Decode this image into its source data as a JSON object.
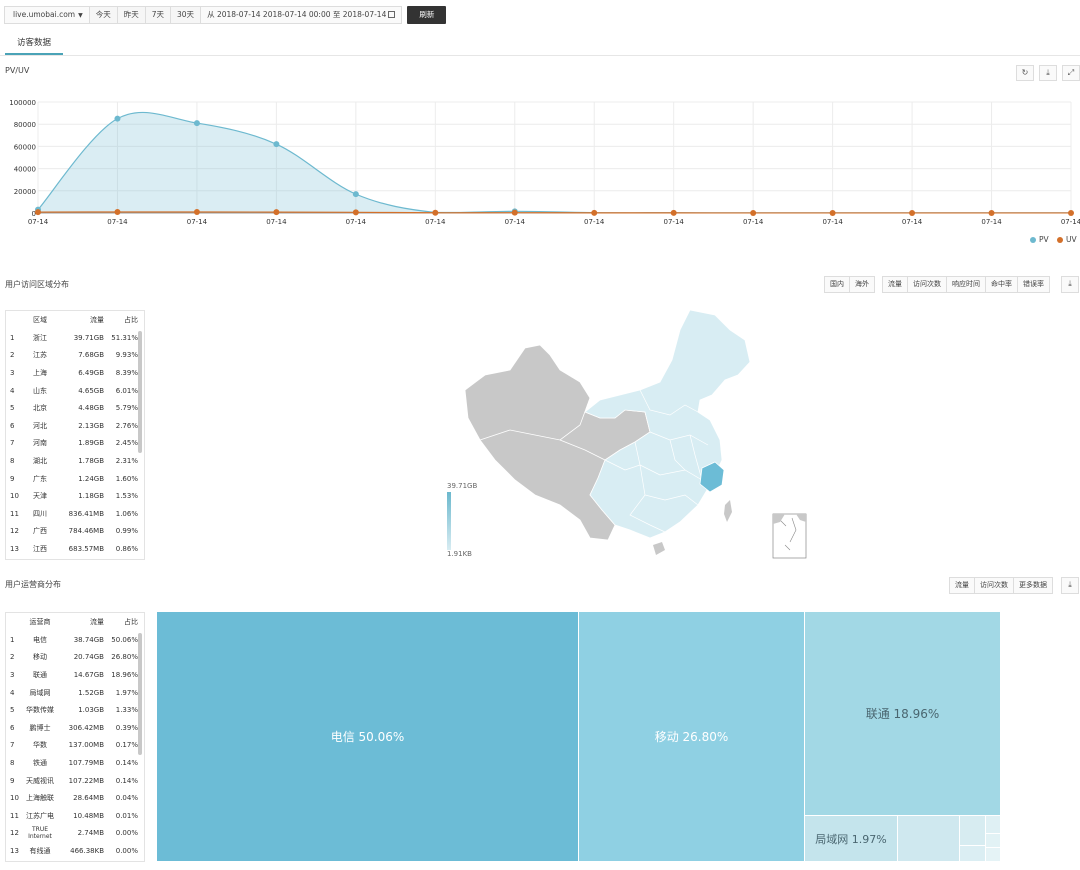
{
  "toolbar": {
    "domain": "live.umobai.com",
    "buttons": [
      "今天",
      "昨天",
      "7天",
      "30天"
    ],
    "range": "从 2018-07-14 2018-07-14 00:00 至 2018-07-14",
    "refresh": "刷新"
  },
  "tab": "访客数据",
  "pv_section": {
    "title": "PV/UV"
  },
  "chart_data": {
    "type": "line",
    "title": "PV/UV",
    "categories": [
      "07-14",
      "07-14",
      "07-14",
      "07-14",
      "07-14",
      "07-14",
      "07-14",
      "07-14",
      "07-14",
      "07-14",
      "07-14",
      "07-14",
      "07-14",
      "07-14"
    ],
    "yticks": [
      "100000",
      "80000",
      "60000",
      "40000",
      "20000",
      "0"
    ],
    "ylim": [
      0,
      100000
    ],
    "series": [
      {
        "name": "PV",
        "color": "#6db9cf",
        "values": [
          3000,
          85000,
          81000,
          62000,
          17000,
          500,
          1500,
          300,
          200,
          100,
          100,
          100,
          100,
          100
        ]
      },
      {
        "name": "UV",
        "color": "#d3702a",
        "values": [
          800,
          900,
          900,
          800,
          600,
          200,
          300,
          100,
          100,
          50,
          50,
          50,
          50,
          50
        ]
      }
    ],
    "legend": [
      "PV",
      "UV"
    ],
    "legend_position": "bottom-right",
    "grid": true
  },
  "region": {
    "title": "用户访问区域分布",
    "scope_tabs": [
      "国内",
      "海外"
    ],
    "metric_tabs": [
      "流量",
      "访问次数",
      "响应时间",
      "命中率",
      "错误率"
    ],
    "header": [
      "区域",
      "流量",
      "占比"
    ],
    "rows": [
      [
        "1",
        "浙江",
        "39.71GB",
        "51.31%"
      ],
      [
        "2",
        "江苏",
        "7.68GB",
        "9.93%"
      ],
      [
        "3",
        "上海",
        "6.49GB",
        "8.39%"
      ],
      [
        "4",
        "山东",
        "4.65GB",
        "6.01%"
      ],
      [
        "5",
        "北京",
        "4.48GB",
        "5.79%"
      ],
      [
        "6",
        "河北",
        "2.13GB",
        "2.76%"
      ],
      [
        "7",
        "河南",
        "1.89GB",
        "2.45%"
      ],
      [
        "8",
        "湖北",
        "1.78GB",
        "2.31%"
      ],
      [
        "9",
        "广东",
        "1.24GB",
        "1.60%"
      ],
      [
        "10",
        "天津",
        "1.18GB",
        "1.53%"
      ],
      [
        "11",
        "四川",
        "836.41MB",
        "1.06%"
      ],
      [
        "12",
        "广西",
        "784.46MB",
        "0.99%"
      ],
      [
        "13",
        "江西",
        "683.57MB",
        "0.86%"
      ]
    ],
    "map_legend_max": "39.71GB",
    "map_legend_min": "1.91KB"
  },
  "isp": {
    "title": "用户运营商分布",
    "metric_tabs": [
      "流量",
      "访问次数",
      "更多数据"
    ],
    "header": [
      "运营商",
      "流量",
      "占比"
    ],
    "rows": [
      [
        "1",
        "电信",
        "38.74GB",
        "50.06%"
      ],
      [
        "2",
        "移动",
        "20.74GB",
        "26.80%"
      ],
      [
        "3",
        "联通",
        "14.67GB",
        "18.96%"
      ],
      [
        "4",
        "局域网",
        "1.52GB",
        "1.97%"
      ],
      [
        "5",
        "华数传媒",
        "1.03GB",
        "1.33%"
      ],
      [
        "6",
        "鹏博士",
        "306.42MB",
        "0.39%"
      ],
      [
        "7",
        "华数",
        "137.00MB",
        "0.17%"
      ],
      [
        "8",
        "铁通",
        "107.79MB",
        "0.14%"
      ],
      [
        "9",
        "天威视讯",
        "107.22MB",
        "0.14%"
      ],
      [
        "10",
        "上海触联",
        "28.64MB",
        "0.04%"
      ],
      [
        "11",
        "江苏广电",
        "10.48MB",
        "0.01%"
      ],
      [
        "12",
        "TRUE Internet",
        "2.74MB",
        "0.00%"
      ],
      [
        "13",
        "有线通",
        "466.38KB",
        "0.00%"
      ]
    ],
    "treemap": [
      {
        "label": "电信 50.06%",
        "color": "#6cbcd6"
      },
      {
        "label": "移动 26.80%",
        "color": "#8fd0e3"
      },
      {
        "label": "联通 18.96%",
        "color": "#a2d8e5"
      },
      {
        "label": "局域网 1.97%",
        "color": "#c4e4ec"
      }
    ]
  }
}
